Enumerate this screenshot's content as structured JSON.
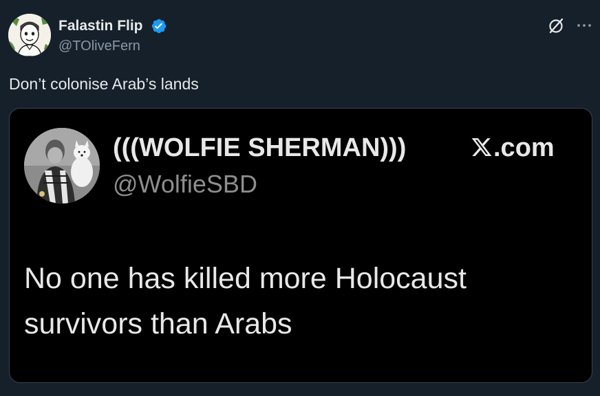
{
  "author": {
    "name": "Falastin Flip",
    "handle": "@TOliveFern",
    "verified": true,
    "verified_color": "#1d9bf0",
    "avatar_icon": "cartoon-face-avatar"
  },
  "header_actions": {
    "grok_icon": "grok-icon",
    "more_icon": "more-horizontal-icon"
  },
  "tweet": {
    "text": "Don’t colonise Arab’s lands"
  },
  "media": {
    "type": "screenshot-of-post",
    "quoted_name": "(((WOLFIE SHERMAN)))",
    "quoted_handle": "@WolfieSBD",
    "source_label": ".com",
    "source_icon": "x-logo-icon",
    "quoted_text": "No one has killed more Holocaust survivors than Arabs"
  },
  "colors": {
    "background": "#15202b",
    "text_primary": "#e7e9ea",
    "text_secondary": "#8b98a5",
    "card_background": "#000000",
    "card_border": "#38444d"
  }
}
